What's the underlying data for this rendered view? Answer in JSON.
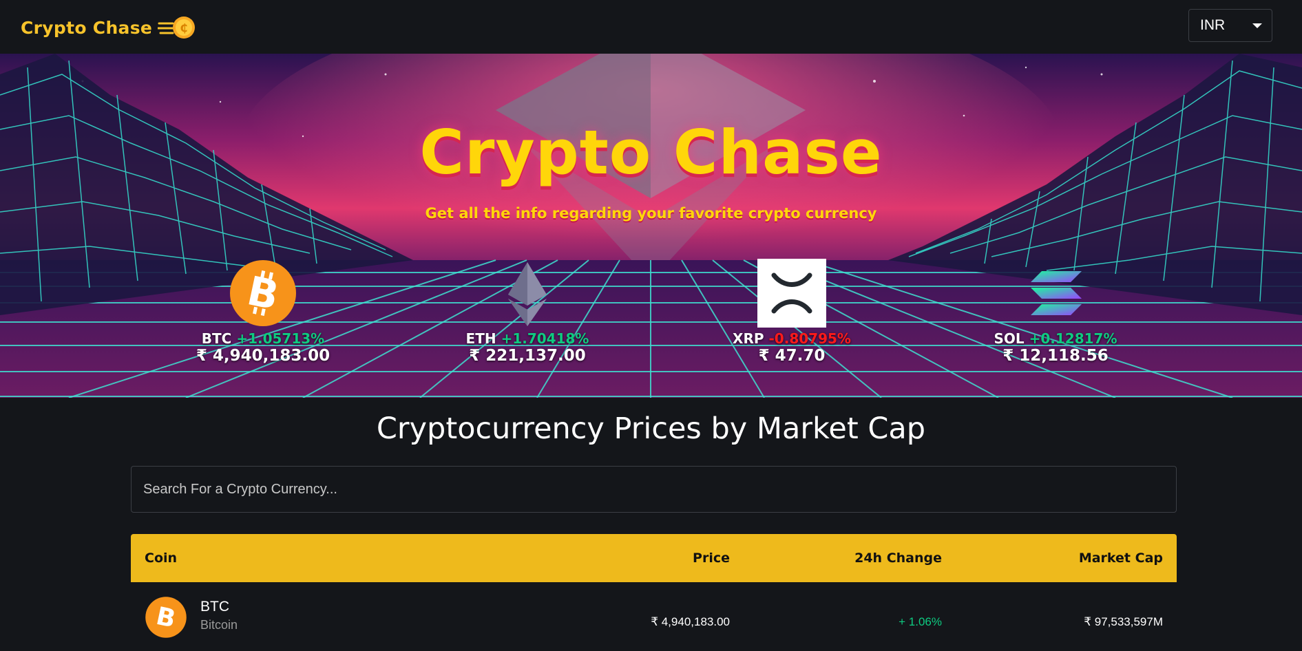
{
  "header": {
    "brand": "Crypto Chase",
    "currency": "INR"
  },
  "banner": {
    "title": "Crypto Chase",
    "subtitle": "Get all the info regarding your favorite crypto currency",
    "coins": [
      {
        "symbol": "BTC",
        "change": "+1.05713%",
        "price": "₹ 4,940,183.00",
        "trend": "up",
        "icon": "bitcoin-icon"
      },
      {
        "symbol": "ETH",
        "change": "+1.70418%",
        "price": "₹ 221,137.00",
        "trend": "up",
        "icon": "ethereum-icon"
      },
      {
        "symbol": "XRP",
        "change": "-0.80795%",
        "price": "₹ 47.70",
        "trend": "down",
        "icon": "xrp-icon"
      },
      {
        "symbol": "SOL",
        "change": "+0.12817%",
        "price": "₹ 12,118.56",
        "trend": "up",
        "icon": "solana-icon"
      }
    ]
  },
  "main": {
    "title": "Cryptocurrency Prices by Market Cap",
    "search_placeholder": "Search For a Crypto Currency...",
    "columns": [
      "Coin",
      "Price",
      "24h Change",
      "Market Cap"
    ],
    "rows": [
      {
        "symbol": "BTC",
        "name": "Bitcoin",
        "price": "₹ 4,940,183.00",
        "change": "+ 1.06%",
        "market_cap": "₹ 97,533,597M"
      }
    ]
  },
  "colors": {
    "accent": "#eeba1c",
    "brand": "#f7c32b",
    "positive": "#0ecb81",
    "negative": "#ff1a1a",
    "background": "#14161a"
  }
}
